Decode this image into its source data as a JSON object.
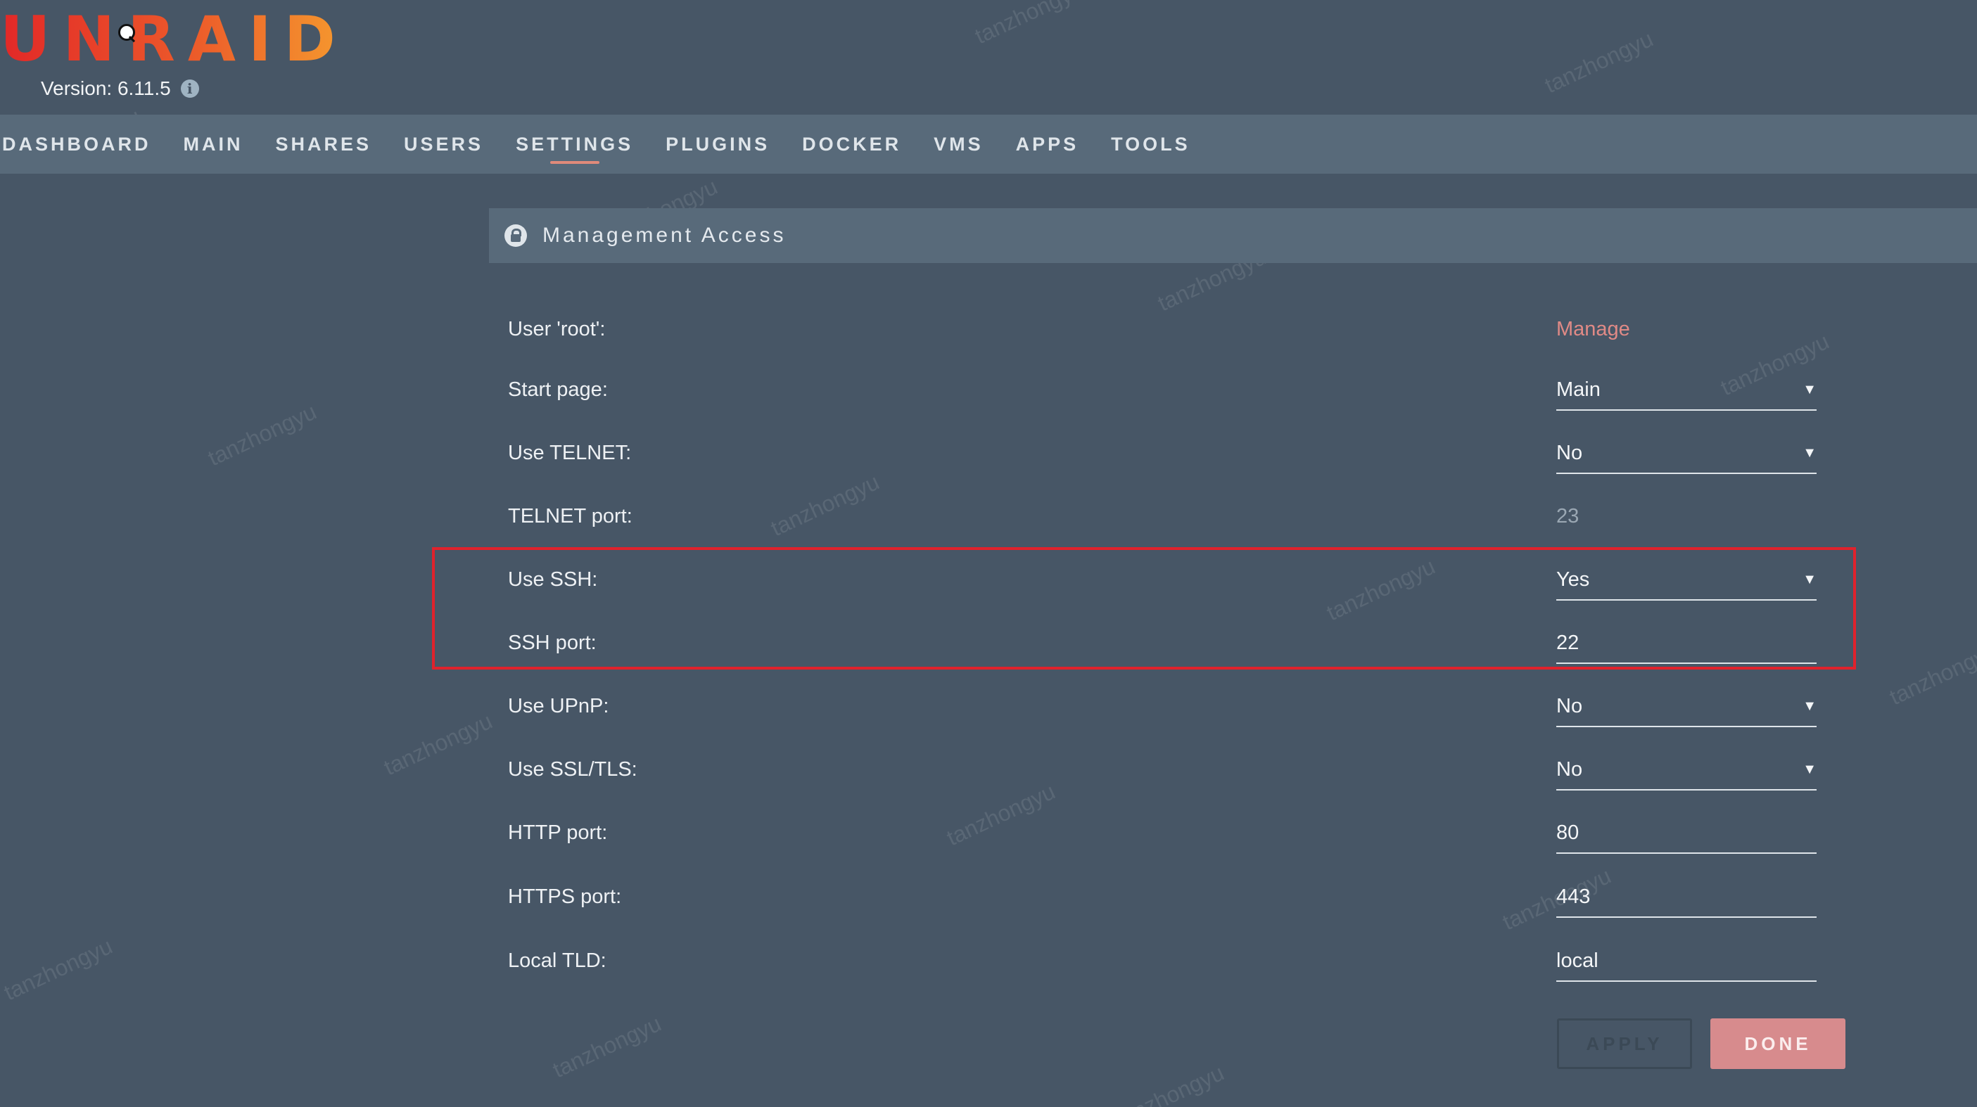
{
  "app": {
    "logo_text": "UNRAID",
    "version_text": "Version: 6.11.5"
  },
  "nav": {
    "items": [
      {
        "label": "DASHBOARD",
        "active": false
      },
      {
        "label": "MAIN",
        "active": false
      },
      {
        "label": "SHARES",
        "active": false
      },
      {
        "label": "USERS",
        "active": false
      },
      {
        "label": "SETTINGS",
        "active": true
      },
      {
        "label": "PLUGINS",
        "active": false
      },
      {
        "label": "DOCKER",
        "active": false
      },
      {
        "label": "VMS",
        "active": false
      },
      {
        "label": "APPS",
        "active": false
      },
      {
        "label": "TOOLS",
        "active": false
      }
    ]
  },
  "section": {
    "title": "Management Access",
    "icon": "lock-icon"
  },
  "form": {
    "user_root": {
      "label": "User 'root':",
      "link": "Manage"
    },
    "start_page": {
      "label": "Start page:",
      "value": "Main"
    },
    "use_telnet": {
      "label": "Use TELNET:",
      "value": "No"
    },
    "telnet_port": {
      "label": "TELNET port:",
      "value": "23"
    },
    "use_ssh": {
      "label": "Use SSH:",
      "value": "Yes"
    },
    "ssh_port": {
      "label": "SSH port:",
      "value": "22"
    },
    "use_upnp": {
      "label": "Use UPnP:",
      "value": "No"
    },
    "use_ssl": {
      "label": "Use SSL/TLS:",
      "value": "No"
    },
    "http_port": {
      "label": "HTTP port:",
      "value": "80"
    },
    "https_port": {
      "label": "HTTPS port:",
      "value": "443"
    },
    "local_tld": {
      "label": "Local TLD:",
      "value": "local"
    }
  },
  "buttons": {
    "apply": "APPLY",
    "done": "DONE"
  },
  "watermark": "tanzhongyu",
  "colors": {
    "background": "#475666",
    "bar": "#586a7a",
    "link": "#e08a86",
    "highlight": "#e0222c",
    "done_button": "#d78b8d"
  }
}
